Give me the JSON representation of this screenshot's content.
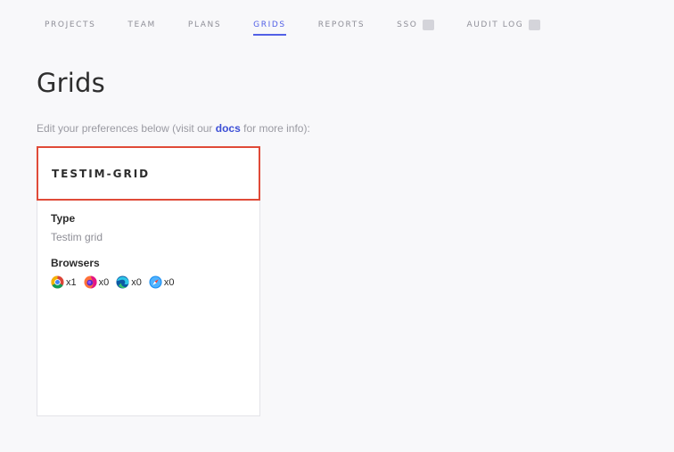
{
  "nav": {
    "items": [
      {
        "label": "PROJECTS"
      },
      {
        "label": "TEAM"
      },
      {
        "label": "PLANS"
      },
      {
        "label": "GRIDS",
        "active": true
      },
      {
        "label": "REPORTS"
      },
      {
        "label": "SSO",
        "locked": true
      },
      {
        "label": "AUDIT LOG",
        "locked": true
      }
    ],
    "active_color": "#5260e6"
  },
  "page": {
    "title": "Grids",
    "subtitle_before": "Edit your preferences below (visit our ",
    "subtitle_link": "docs",
    "subtitle_after": " for more info):"
  },
  "card": {
    "title": "TESTIM-GRID",
    "highlight_color": "#e04a38",
    "type_label": "Type",
    "type_value": "Testim grid",
    "browsers_label": "Browsers",
    "browsers": [
      {
        "name": "chrome-icon",
        "count": "x1"
      },
      {
        "name": "firefox-icon",
        "count": "x0"
      },
      {
        "name": "edge-icon",
        "count": "x0"
      },
      {
        "name": "safari-icon",
        "count": "x0"
      }
    ]
  }
}
